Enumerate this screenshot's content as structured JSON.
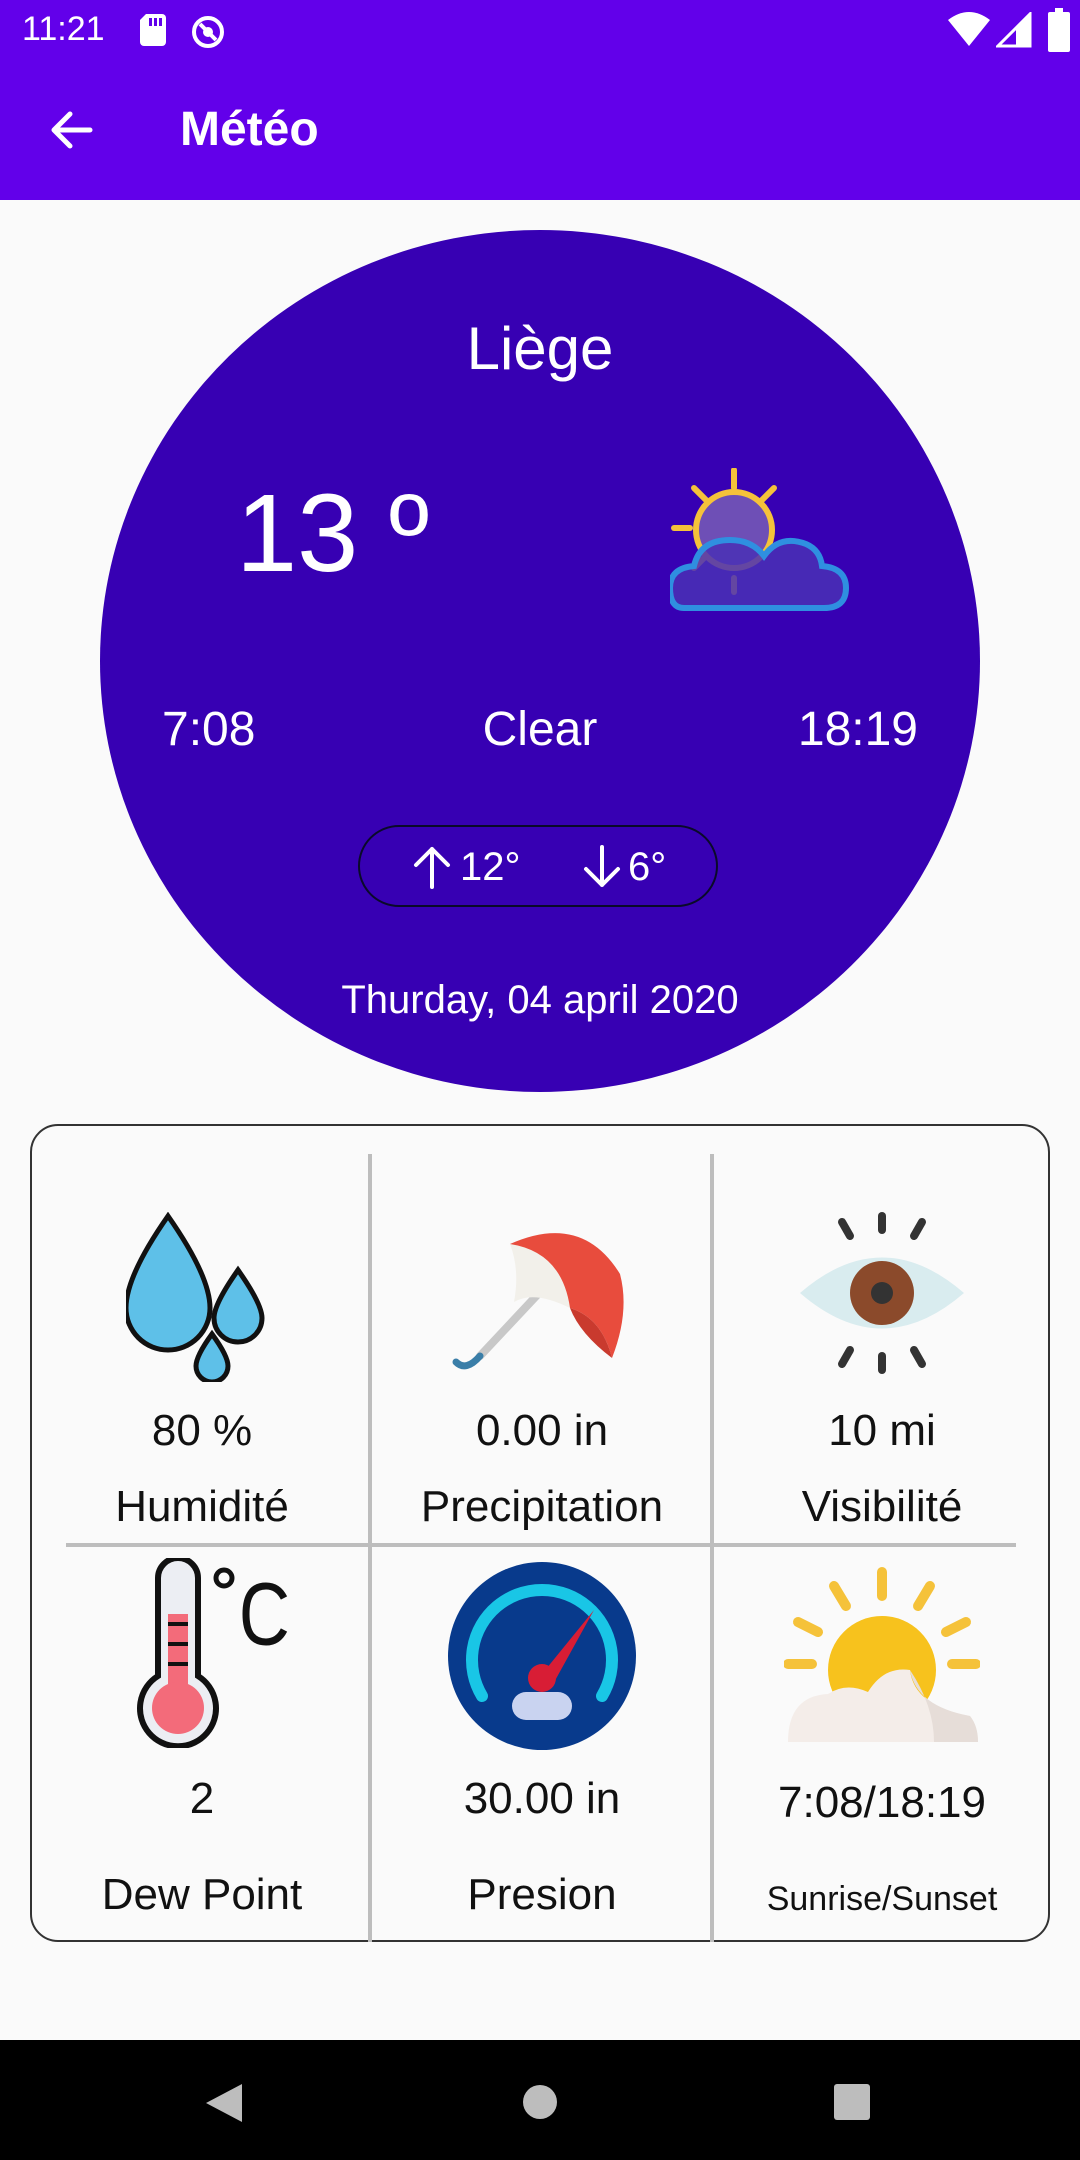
{
  "status_bar": {
    "time": "11:21"
  },
  "app_bar": {
    "title": "Météo"
  },
  "weather": {
    "city": "Liège",
    "temperature": "13 º",
    "condition": "Clear",
    "sunrise": "7:08",
    "sunset": "18:19",
    "high": "12°",
    "low": "6°",
    "date": "Thurday, 04 april 2020",
    "icon": "sun-behind-cloud-icon"
  },
  "details": [
    {
      "value": "80 %",
      "label": "Humidité",
      "icon": "raindrops-icon"
    },
    {
      "value": "0.00 in",
      "label": "Precipitation",
      "icon": "umbrella-icon"
    },
    {
      "value": "10 mi",
      "label": "Visibilité",
      "icon": "eye-icon"
    },
    {
      "value": "2",
      "label": "Dew Point",
      "icon": "thermometer-icon"
    },
    {
      "value": "30.00 in",
      "label": "Presion",
      "icon": "pressure-gauge-icon"
    },
    {
      "value": "7:08/18:19",
      "label": "Sunrise/Sunset",
      "icon": "sunrise-icon"
    }
  ],
  "colors": {
    "primary": "#6200ea",
    "circle": "#3700b3",
    "background": "#fafafa"
  }
}
